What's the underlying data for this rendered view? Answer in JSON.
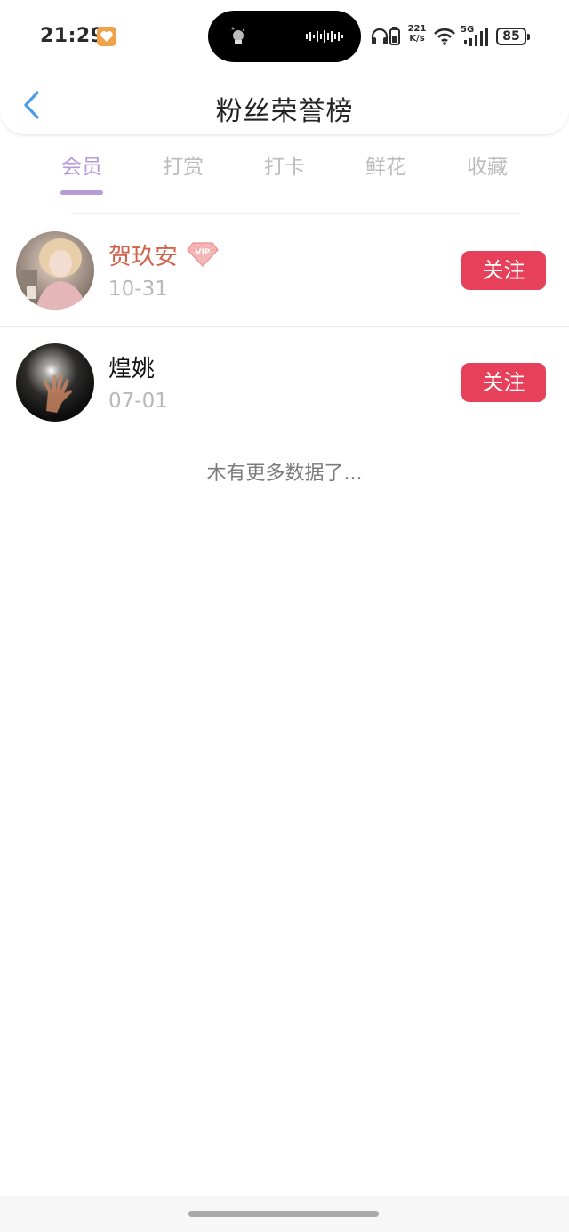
{
  "status_bar": {
    "time": "21:29",
    "net_speed_value": "221",
    "net_speed_unit": "K/s",
    "network_type": "5G",
    "battery": "85",
    "icons": [
      "heart-icon",
      "headphones-icon",
      "battery-small-icon",
      "wifi-icon",
      "signal-icon"
    ]
  },
  "nav": {
    "title": "粉丝荣誉榜",
    "back_icon": "chevron-left-icon",
    "accent_color": "#4a9be8"
  },
  "tabs": [
    {
      "label": "会员",
      "active": true
    },
    {
      "label": "打赏",
      "active": false
    },
    {
      "label": "打卡",
      "active": false
    },
    {
      "label": "鲜花",
      "active": false
    },
    {
      "label": "收藏",
      "active": false
    }
  ],
  "colors": {
    "tab_active": "#b79ad8",
    "tab_inactive": "#bdbdbd",
    "follow_button": "#e6405a",
    "vip_name": "#d0614a"
  },
  "fans": [
    {
      "name": "贺玖安",
      "date": "10-31",
      "vip": true,
      "vip_badge_text": "VIP",
      "follow_label": "关注"
    },
    {
      "name": "煌姚",
      "date": "07-01",
      "vip": false,
      "follow_label": "关注"
    }
  ],
  "footer_text": "木有更多数据了..."
}
